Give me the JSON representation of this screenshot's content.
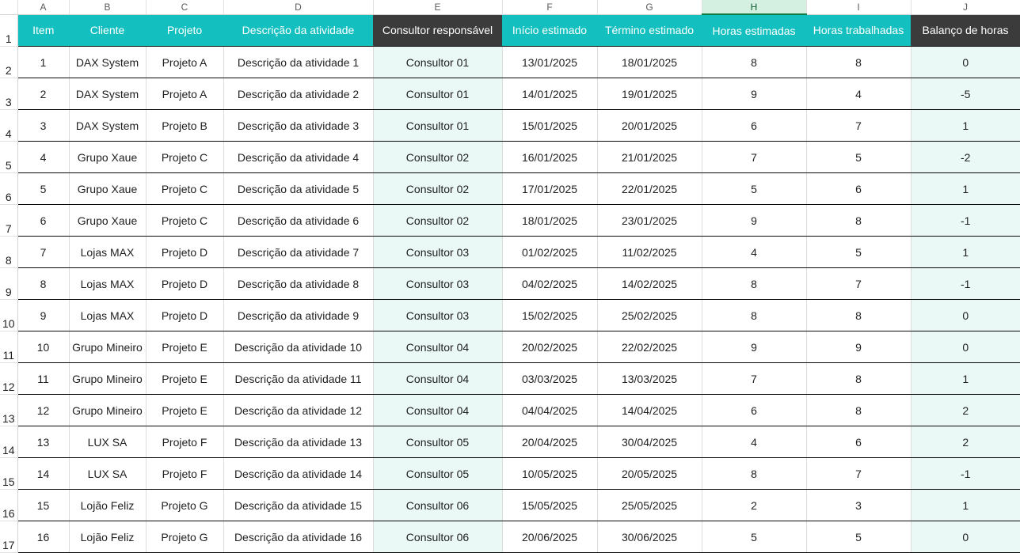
{
  "spreadsheet": {
    "column_letters": [
      "A",
      "B",
      "C",
      "D",
      "E",
      "F",
      "G",
      "H",
      "I",
      "J"
    ],
    "selected_column": "H",
    "header_row_number": "1",
    "headers": [
      "Item",
      "Cliente",
      "Projeto",
      "Descrição da atividade",
      "Consultor responsável",
      "Início estimado",
      "Término estimado",
      "Horas estimadas",
      "Horas trabalhadas",
      "Balanço de horas"
    ],
    "rows": [
      {
        "row_number": "2",
        "cells": [
          "1",
          "DAX System",
          "Projeto A",
          "Descrição da atividade 1",
          "Consultor 01",
          "13/01/2025",
          "18/01/2025",
          "8",
          "8",
          "0"
        ]
      },
      {
        "row_number": "3",
        "cells": [
          "2",
          "DAX System",
          "Projeto A",
          "Descrição da atividade 2",
          "Consultor 01",
          "14/01/2025",
          "19/01/2025",
          "9",
          "4",
          "-5"
        ]
      },
      {
        "row_number": "4",
        "cells": [
          "3",
          "DAX System",
          "Projeto B",
          "Descrição da atividade 3",
          "Consultor 01",
          "15/01/2025",
          "20/01/2025",
          "6",
          "7",
          "1"
        ]
      },
      {
        "row_number": "5",
        "cells": [
          "4",
          "Grupo Xaue",
          "Projeto C",
          "Descrição da atividade 4",
          "Consultor 02",
          "16/01/2025",
          "21/01/2025",
          "7",
          "5",
          "-2"
        ]
      },
      {
        "row_number": "6",
        "cells": [
          "5",
          "Grupo Xaue",
          "Projeto C",
          "Descrição da atividade 5",
          "Consultor 02",
          "17/01/2025",
          "22/01/2025",
          "5",
          "6",
          "1"
        ]
      },
      {
        "row_number": "7",
        "cells": [
          "6",
          "Grupo Xaue",
          "Projeto C",
          "Descrição da atividade 6",
          "Consultor 02",
          "18/01/2025",
          "23/01/2025",
          "9",
          "8",
          "-1"
        ]
      },
      {
        "row_number": "8",
        "cells": [
          "7",
          "Lojas MAX",
          "Projeto D",
          "Descrição da atividade 7",
          "Consultor 03",
          "01/02/2025",
          "11/02/2025",
          "4",
          "5",
          "1"
        ]
      },
      {
        "row_number": "9",
        "cells": [
          "8",
          "Lojas MAX",
          "Projeto D",
          "Descrição da atividade 8",
          "Consultor 03",
          "04/02/2025",
          "14/02/2025",
          "8",
          "7",
          "-1"
        ]
      },
      {
        "row_number": "10",
        "cells": [
          "9",
          "Lojas MAX",
          "Projeto D",
          "Descrição da atividade 9",
          "Consultor 03",
          "15/02/2025",
          "25/02/2025",
          "8",
          "8",
          "0"
        ]
      },
      {
        "row_number": "11",
        "cells": [
          "10",
          "Grupo Mineiro",
          "Projeto E",
          "Descrição da atividade 10",
          "Consultor 04",
          "20/02/2025",
          "22/02/2025",
          "9",
          "9",
          "0"
        ]
      },
      {
        "row_number": "12",
        "cells": [
          "11",
          "Grupo Mineiro",
          "Projeto E",
          "Descrição da atividade 11",
          "Consultor 04",
          "03/03/2025",
          "13/03/2025",
          "7",
          "8",
          "1"
        ]
      },
      {
        "row_number": "13",
        "cells": [
          "12",
          "Grupo Mineiro",
          "Projeto E",
          "Descrição da atividade 12",
          "Consultor 04",
          "04/04/2025",
          "14/04/2025",
          "6",
          "8",
          "2"
        ]
      },
      {
        "row_number": "14",
        "cells": [
          "13",
          "LUX SA",
          "Projeto F",
          "Descrição da atividade 13",
          "Consultor 05",
          "20/04/2025",
          "30/04/2025",
          "4",
          "6",
          "2"
        ]
      },
      {
        "row_number": "15",
        "cells": [
          "14",
          "LUX SA",
          "Projeto F",
          "Descrição da atividade 14",
          "Consultor 05",
          "10/05/2025",
          "20/05/2025",
          "8",
          "7",
          "-1"
        ]
      },
      {
        "row_number": "16",
        "cells": [
          "15",
          "Lojão Feliz",
          "Projeto G",
          "Descrição da atividade 15",
          "Consultor 06",
          "15/05/2025",
          "25/05/2025",
          "2",
          "3",
          "1"
        ]
      },
      {
        "row_number": "17",
        "cells": [
          "16",
          "Lojão Feliz",
          "Projeto G",
          "Descrição da atividade 16",
          "Consultor 06",
          "20/06/2025",
          "30/06/2025",
          "5",
          "5",
          "0"
        ]
      }
    ],
    "colors": {
      "header_teal": "#13bfbf",
      "header_dark": "#3b3b3b",
      "tint_column": "#eaf8f6",
      "selected_column_header": "#d3f0e0",
      "selection_accent": "#107c41"
    }
  }
}
